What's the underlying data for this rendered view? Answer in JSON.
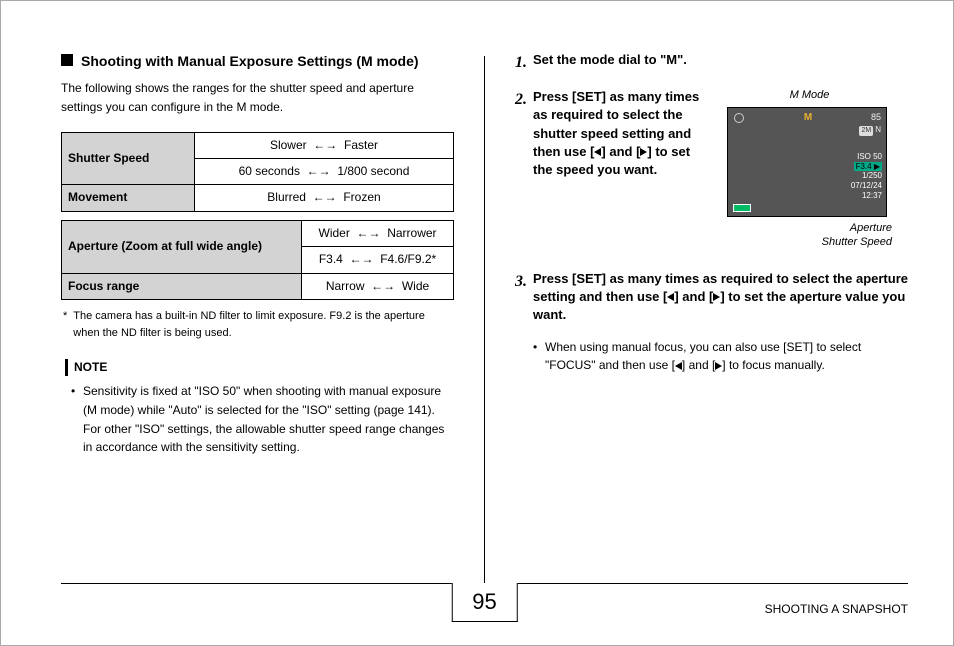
{
  "left": {
    "heading": "Shooting with Manual Exposure Settings (M mode)",
    "intro": "The following shows the ranges for the shutter speed and aperture settings you can configure in the M mode.",
    "table1": {
      "row1_label": "Shutter Speed",
      "row1a_left": "Slower",
      "row1a_right": "Faster",
      "row1b_left": "60 seconds",
      "row1b_right": "1/800 second",
      "row2_label": "Movement",
      "row2_left": "Blurred",
      "row2_right": "Frozen"
    },
    "table2": {
      "row1_label": "Aperture (Zoom at full wide angle)",
      "row1a_left": "Wider",
      "row1a_right": "Narrower",
      "row1b_left": "F3.4",
      "row1b_right": "F4.6/F9.2*",
      "row2_label": "Focus range",
      "row2_left": "Narrow",
      "row2_right": "Wide"
    },
    "footnote_mark": "*",
    "footnote": "The camera has a built-in ND filter to limit exposure. F9.2 is the aperture when the ND filter is being used.",
    "note_label": "NOTE",
    "note_body": "Sensitivity is fixed at \"ISO 50\" when shooting with manual exposure (M mode) while \"Auto\" is selected for the \"ISO\" setting (page 141). For other \"ISO\" settings, the allowable shutter speed range changes in accordance with the sensitivity setting."
  },
  "right": {
    "step1_num": "1.",
    "step1": "Set the mode dial to \"M\".",
    "step2_num": "2.",
    "step2_a": "Press [SET] as many times as required to select the shutter speed setting and then use [",
    "step2_b": "] and [",
    "step2_c": "] to set the speed you want.",
    "screen": {
      "top_label": "M Mode",
      "m_badge": "M",
      "right_count": "85",
      "em_n": "N",
      "iso": "ISO 50",
      "fstop": "F3.4 ▶",
      "shutter": "1/250",
      "date": "07/12/24",
      "time": "12:37",
      "bottom_labels": [
        "Aperture",
        "Shutter Speed"
      ]
    },
    "step3_num": "3.",
    "step3_a": "Press [SET] as many times as required to select the aperture setting and then use [",
    "step3_b": "] and [",
    "step3_c": "] to set the aperture value you want.",
    "sub_a": "When using manual focus, you can also use [SET] to select \"FOCUS\" and then use [",
    "sub_b": "] and [",
    "sub_c": "] to focus manually."
  },
  "footer": {
    "page": "95",
    "section": "SHOOTING A SNAPSHOT"
  }
}
